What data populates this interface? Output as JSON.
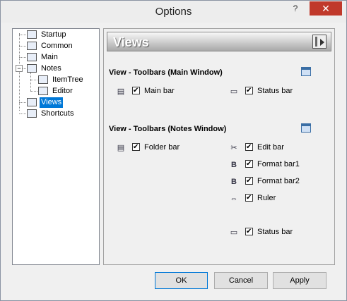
{
  "window": {
    "title": "Options",
    "help_label": "?",
    "close_label": "✕"
  },
  "tree": {
    "items": [
      {
        "label": "Startup"
      },
      {
        "label": "Common"
      },
      {
        "label": "Main"
      },
      {
        "label": "Notes"
      },
      {
        "label": "ItemTree"
      },
      {
        "label": "Editor"
      },
      {
        "label": "Views"
      },
      {
        "label": "Shortcuts"
      }
    ],
    "selected": "Views"
  },
  "panel": {
    "banner_title": "Views",
    "main_group": {
      "title": "View - Toolbars (Main Window)",
      "options": [
        {
          "label": "Main bar",
          "checked": true
        },
        {
          "label": "Status bar",
          "checked": true
        }
      ]
    },
    "notes_group": {
      "title": "View - Toolbars (Notes Window)",
      "options": [
        {
          "label": "Folder bar",
          "checked": true
        },
        {
          "label": "Edit bar",
          "checked": true
        },
        {
          "label": "Format bar1",
          "checked": true
        },
        {
          "label": "Format bar2",
          "checked": true
        },
        {
          "label": "Ruler",
          "checked": true
        },
        {
          "label": "Status bar",
          "checked": true
        }
      ]
    }
  },
  "buttons": {
    "ok": "OK",
    "cancel": "Cancel",
    "apply": "Apply"
  }
}
